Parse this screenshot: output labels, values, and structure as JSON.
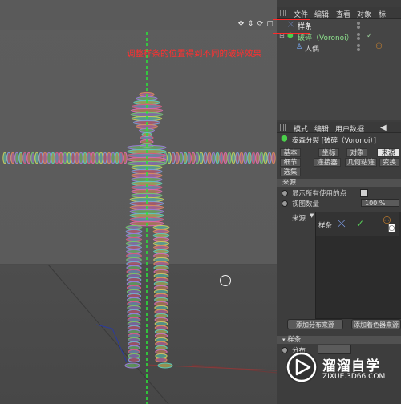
{
  "viewport": {
    "annotation": "调整样条的位置得到不同的破碎效果",
    "nav_icons": [
      "move-icon",
      "zoom-icon",
      "rotate-icon",
      "maximize-icon"
    ]
  },
  "object_manager": {
    "menu": [
      "文件",
      "编辑",
      "查看",
      "对象",
      "标"
    ],
    "objects": [
      {
        "name": "样条",
        "icon": "spline-icon",
        "indent": 0
      },
      {
        "name": "破碎（Voronoi）",
        "icon": "voronoi-icon",
        "indent": 0
      },
      {
        "name": "人偶",
        "icon": "figure-icon",
        "indent": 1
      }
    ]
  },
  "attribute_manager": {
    "menu": [
      "模式",
      "编辑",
      "用户数据"
    ],
    "title": "泰森分裂 [破碎（Voronoi）]",
    "tabs_row1": [
      "基本",
      "坐标",
      "对象",
      "来源"
    ],
    "tabs_row2": [
      "细节",
      "连接器",
      "几何粘连",
      "变换"
    ],
    "tabs_row3": [
      "选集"
    ],
    "active_tab": "来源",
    "section_title": "来源",
    "show_all_points_label": "显示所有使用的点",
    "viewport_amount_label": "视图数量",
    "viewport_amount_value": "100 %",
    "source_label": "来源",
    "source_item": "样条",
    "add_distribution_button": "添加分布来源",
    "add_shader_button": "添加着色器来源",
    "spline_section": "样条",
    "distribution_label": "分布",
    "accent_red": "#ff2a2a",
    "check_green": "#58d058"
  },
  "watermark": {
    "main": "溜溜自学",
    "sub": "ZIXUE.3D66.COM"
  }
}
